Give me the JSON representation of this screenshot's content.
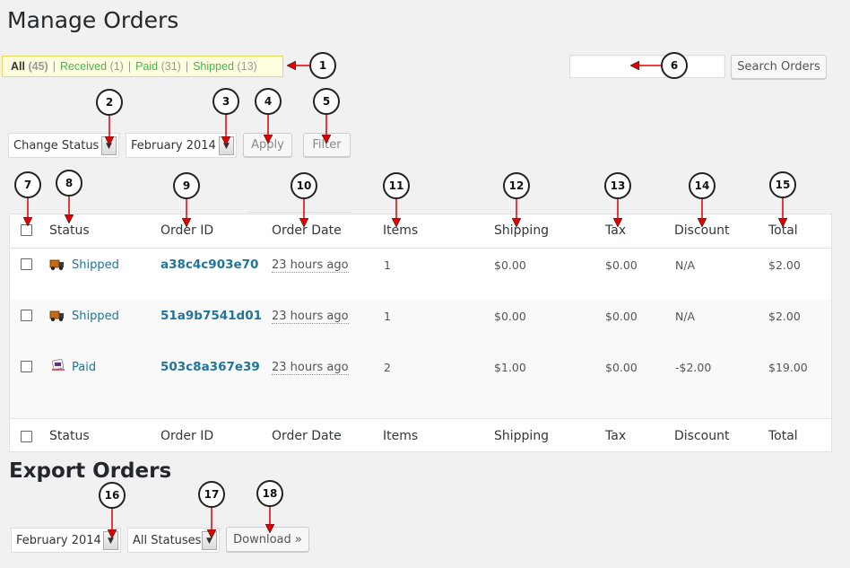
{
  "page_title": "Manage Orders",
  "filters": [
    {
      "label": "All",
      "count": "(45)"
    },
    {
      "label": "Received",
      "count": "(1)"
    },
    {
      "label": "Paid",
      "count": "(31)"
    },
    {
      "label": "Shipped",
      "count": "(13)"
    }
  ],
  "search": {
    "button_label": "Search Orders",
    "value": ""
  },
  "bulk": {
    "status_select": "Change Status",
    "month_select": "February 2014",
    "apply_label": "Apply",
    "filter_label": "Filter"
  },
  "table": {
    "headers": [
      "Status",
      "Order ID",
      "Order Date",
      "Items",
      "Shipping",
      "Tax",
      "Discount",
      "Total"
    ],
    "rows": [
      {
        "status": "Shipped",
        "status_icon": "truck-icon",
        "order_id": "a38c4c903e70",
        "date": "23 hours ago",
        "items": "1",
        "shipping": "$0.00",
        "tax": "$0.00",
        "discount": "N/A",
        "total": "$2.00"
      },
      {
        "status": "Shipped",
        "status_icon": "truck-icon",
        "order_id": "51a9b7541d01",
        "date": "23 hours ago",
        "items": "1",
        "shipping": "$0.00",
        "tax": "$0.00",
        "discount": "N/A",
        "total": "$2.00"
      },
      {
        "status": "Paid",
        "status_icon": "paid-icon",
        "order_id": "503c8a367e39",
        "date": "23 hours ago",
        "items": "2",
        "shipping": "$1.00",
        "tax": "$0.00",
        "discount": "-$2.00",
        "total": "$19.00"
      }
    ]
  },
  "export": {
    "title": "Export Orders",
    "month_select": "February 2014",
    "status_select": "All Statuses",
    "download_label": "Download »"
  },
  "callouts": [
    "1",
    "2",
    "3",
    "4",
    "5",
    "6",
    "7",
    "8",
    "9",
    "10",
    "11",
    "12",
    "13",
    "14",
    "15",
    "16",
    "17",
    "18"
  ],
  "colors": {
    "accent": "#21759b",
    "filter_link": "#46b450",
    "callout_arrow": "#e00000"
  }
}
